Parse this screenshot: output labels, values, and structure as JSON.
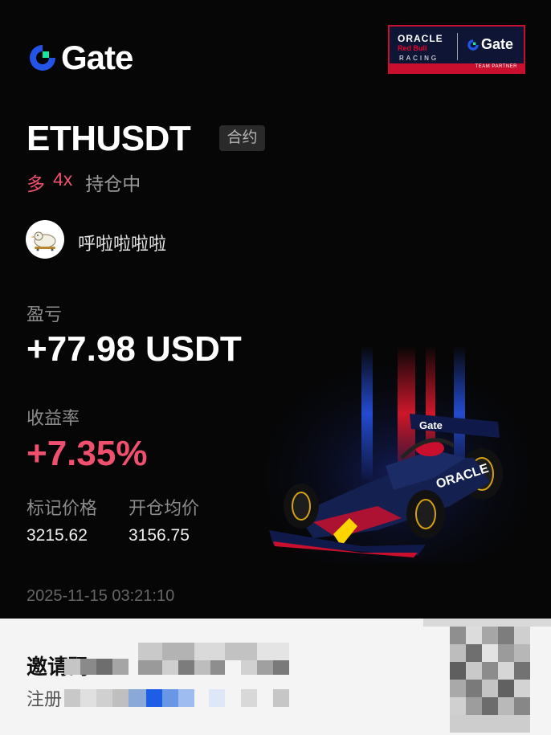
{
  "brand": {
    "name": "Gate"
  },
  "partner": {
    "line1": "ORACLE",
    "line2": "Red Bull",
    "line3": "RACING",
    "gate": "Gate",
    "tag": "TEAM PARTNER"
  },
  "position": {
    "pair": "ETHUSDT",
    "contract_tag": "合约",
    "side": "多",
    "leverage": "4x",
    "status": "持仓中"
  },
  "user": {
    "name": "呼啦啦啦啦"
  },
  "pnl": {
    "label": "盈亏",
    "value": "+77.98 USDT"
  },
  "roi": {
    "label": "收益率",
    "value": "+7.35%"
  },
  "prices": {
    "mark_label": "标记价格",
    "mark_value": "3215.62",
    "entry_label": "开仓均价",
    "entry_value": "3156.75"
  },
  "timestamp": "2025-11-15 03:21:10",
  "footer": {
    "invite_label": "邀请码：VI",
    "register_label": "注册"
  },
  "colors": {
    "positive": "#f0506e",
    "background": "#060606",
    "brand": "#2354e6"
  }
}
